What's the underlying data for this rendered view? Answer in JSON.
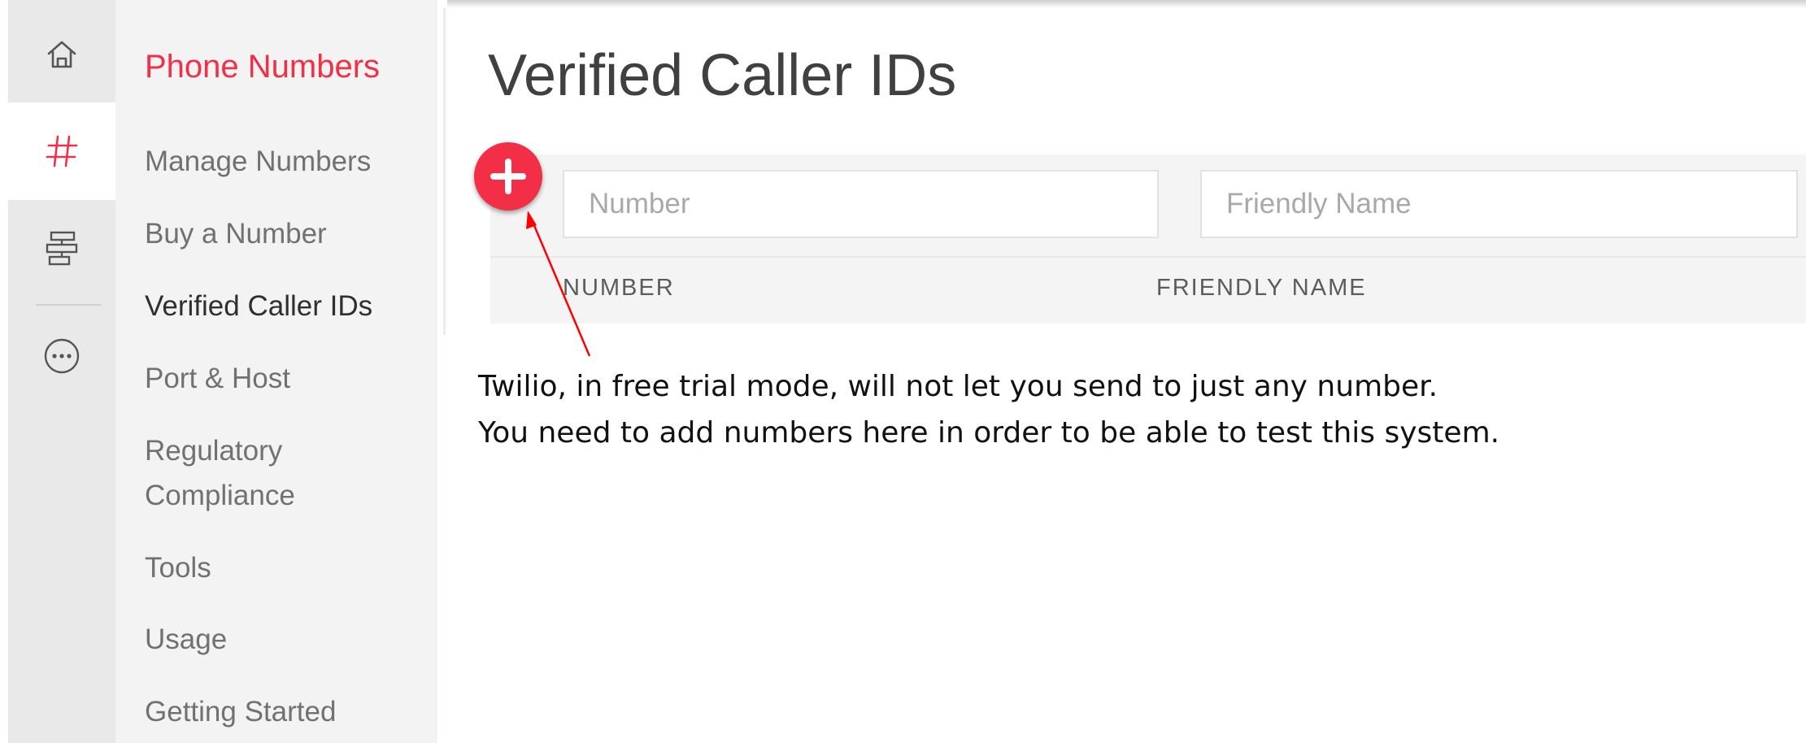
{
  "rail": {
    "items": [
      {
        "icon": "home-icon",
        "active": false
      },
      {
        "icon": "hash-icon",
        "active": true
      },
      {
        "icon": "elastic-sip-trunking-icon",
        "active": false
      },
      {
        "icon": "more-icon",
        "active": false
      }
    ]
  },
  "nav": {
    "title": "Phone Numbers",
    "items": [
      {
        "label": "Manage Numbers"
      },
      {
        "label": "Buy a Number"
      },
      {
        "label": "Verified Caller IDs"
      },
      {
        "label": "Port & Host"
      },
      {
        "label": "Regulatory"
      },
      {
        "label": "Compliance"
      },
      {
        "label": "Tools"
      },
      {
        "label": "Usage"
      },
      {
        "label": "Getting Started"
      }
    ]
  },
  "main": {
    "title": "Verified Caller IDs",
    "filters": {
      "number_placeholder": "Number",
      "number_value": "",
      "friendly_name_placeholder": "Friendly Name",
      "friendly_name_value": ""
    },
    "table": {
      "columns": [
        "NUMBER",
        "FRIENDLY NAME"
      ]
    }
  },
  "annotation": {
    "lines": [
      "Twilio, in free trial mode, will not let you send to just any number.",
      "You need to add numbers here in order to be able to test this system."
    ]
  },
  "colors": {
    "brand": "#f22f46",
    "arrow": "#ff0000"
  }
}
